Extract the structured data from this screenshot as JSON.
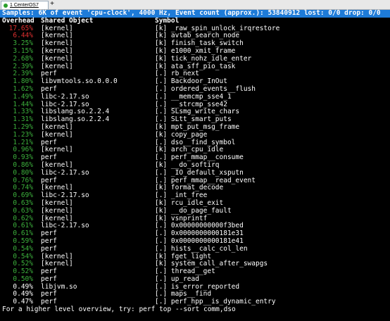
{
  "tab": {
    "title": "1 CenterOS7",
    "plus": "+"
  },
  "samples_line": "Samples: 6K of event 'cpu-clock', 4000 Hz, Event count (approx.): 53840912 lost: 0/0 drop: 0/0",
  "headers": {
    "overhead": "Overhead",
    "shared_object": "Shared Object",
    "symbol": "Symbol"
  },
  "rows": [
    {
      "pct": "17.65%",
      "obj": "[kernel]",
      "sym": "[k] _raw_spin_unlock_irqrestore",
      "color": "#e03030"
    },
    {
      "pct": "6.44%",
      "obj": "[kernel]",
      "sym": "[k] avtab_search_node",
      "color": "#e03030"
    },
    {
      "pct": "3.25%",
      "obj": "[kernel]",
      "sym": "[k] finish_task_switch",
      "color": "#3cb03c"
    },
    {
      "pct": "3.15%",
      "obj": "[kernel]",
      "sym": "[k] e1000_xmit_frame",
      "color": "#3cb03c"
    },
    {
      "pct": "2.68%",
      "obj": "[kernel]",
      "sym": "[k] tick_nohz_idle_enter",
      "color": "#3cb03c"
    },
    {
      "pct": "2.39%",
      "obj": "[kernel]",
      "sym": "[k] ata_sff_pio_task",
      "color": "#3cb03c"
    },
    {
      "pct": "2.39%",
      "obj": "perf",
      "sym": "[.] rb_next",
      "color": "#3cb03c"
    },
    {
      "pct": "1.80%",
      "obj": "libvmtools.so.0.0.0",
      "sym": "[.] Backdoor_InOut",
      "color": "#3cb03c"
    },
    {
      "pct": "1.62%",
      "obj": "perf",
      "sym": "[.] ordered_events__flush",
      "color": "#3cb03c"
    },
    {
      "pct": "1.49%",
      "obj": "libc-2.17.so",
      "sym": "[.] __memcmp_sse4_1",
      "color": "#3cb03c"
    },
    {
      "pct": "1.44%",
      "obj": "libc-2.17.so",
      "sym": "[.] __strcmp_sse42",
      "color": "#3cb03c"
    },
    {
      "pct": "1.33%",
      "obj": "libslang.so.2.2.4",
      "sym": "[.] SLsmg_write_chars",
      "color": "#3cb03c"
    },
    {
      "pct": "1.31%",
      "obj": "libslang.so.2.2.4",
      "sym": "[.] SLtt_smart_puts",
      "color": "#3cb03c"
    },
    {
      "pct": "1.29%",
      "obj": "[kernel]",
      "sym": "[k] mpt_put_msg_frame",
      "color": "#3cb03c"
    },
    {
      "pct": "1.23%",
      "obj": "[kernel]",
      "sym": "[k] copy_page",
      "color": "#3cb03c"
    },
    {
      "pct": "1.21%",
      "obj": "perf",
      "sym": "[.] dso__find_symbol",
      "color": "#3cb03c"
    },
    {
      "pct": "0.96%",
      "obj": "[kernel]",
      "sym": "[k] arch_cpu_idle",
      "color": "#3cb03c"
    },
    {
      "pct": "0.93%",
      "obj": "perf",
      "sym": "[.] perf_mmap__consume",
      "color": "#3cb03c"
    },
    {
      "pct": "0.86%",
      "obj": "[kernel]",
      "sym": "[k] __do_softirq",
      "color": "#3cb03c"
    },
    {
      "pct": "0.80%",
      "obj": "libc-2.17.so",
      "sym": "[.] _IO_default_xsputn",
      "color": "#3cb03c"
    },
    {
      "pct": "0.76%",
      "obj": "perf",
      "sym": "[.] perf_mmap__read_event",
      "color": "#3cb03c"
    },
    {
      "pct": "0.74%",
      "obj": "[kernel]",
      "sym": "[k] format_decode",
      "color": "#3cb03c"
    },
    {
      "pct": "0.69%",
      "obj": "libc-2.17.so",
      "sym": "[.] _int_free",
      "color": "#3cb03c"
    },
    {
      "pct": "0.63%",
      "obj": "[kernel]",
      "sym": "[k] rcu_idle_exit",
      "color": "#3cb03c"
    },
    {
      "pct": "0.63%",
      "obj": "[kernel]",
      "sym": "[k] __do_page_fault",
      "color": "#3cb03c"
    },
    {
      "pct": "0.62%",
      "obj": "[kernel]",
      "sym": "[k] vsnprintf",
      "color": "#3cb03c"
    },
    {
      "pct": "0.61%",
      "obj": "libc-2.17.so",
      "sym": "[.] 0x00000000000f3bed",
      "color": "#3cb03c"
    },
    {
      "pct": "0.61%",
      "obj": "perf",
      "sym": "[.] 0x0000000000181e31",
      "color": "#3cb03c"
    },
    {
      "pct": "0.59%",
      "obj": "perf",
      "sym": "[.] 0x0000000000181e41",
      "color": "#3cb03c"
    },
    {
      "pct": "0.54%",
      "obj": "perf",
      "sym": "[.] hists__calc_col_len",
      "color": "#3cb03c"
    },
    {
      "pct": "0.54%",
      "obj": "[kernel]",
      "sym": "[k] fget_light",
      "color": "#3cb03c"
    },
    {
      "pct": "0.52%",
      "obj": "[kernel]",
      "sym": "[k] system_call_after_swapgs",
      "color": "#3cb03c"
    },
    {
      "pct": "0.52%",
      "obj": "perf",
      "sym": "[.] thread__get",
      "color": "#3cb03c"
    },
    {
      "pct": "0.50%",
      "obj": "perf",
      "sym": "[.] up_read",
      "color": "#3cb03c"
    },
    {
      "pct": "0.49%",
      "obj": "libjvm.so",
      "sym": "[.] is_error_reported",
      "color": "#ffffff"
    },
    {
      "pct": "0.49%",
      "obj": "perf",
      "sym": "[.] maps__find",
      "color": "#ffffff"
    },
    {
      "pct": "0.47%",
      "obj": "perf",
      "sym": "[.] perf_hpp__is_dynamic_entry",
      "color": "#ffffff"
    }
  ],
  "footer": "For a higher level overview, try: perf top --sort comm,dso"
}
